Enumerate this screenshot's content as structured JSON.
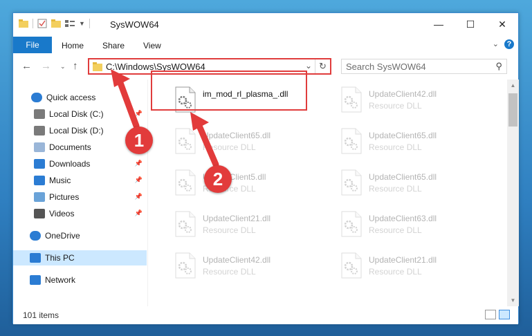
{
  "window": {
    "title": "SysWOW64",
    "controls": {
      "minimize": "—",
      "maximize": "☐",
      "close": "✕"
    }
  },
  "ribbon": {
    "tabs": [
      "File",
      "Home",
      "Share",
      "View"
    ],
    "help": "?"
  },
  "address": {
    "path": "C:\\Windows\\SysWOW64",
    "search_placeholder": "Search SysWOW64"
  },
  "nav": {
    "items": [
      {
        "label": "Quick access",
        "icon": "star-icon"
      },
      {
        "label": "Local Disk (C:)",
        "icon": "drive-icon",
        "pinned": true
      },
      {
        "label": "Local Disk (D:)",
        "icon": "drive-icon",
        "pinned": true
      },
      {
        "label": "Documents",
        "icon": "document-icon",
        "pinned": true
      },
      {
        "label": "Downloads",
        "icon": "download-icon",
        "pinned": true
      },
      {
        "label": "Music",
        "icon": "music-icon",
        "pinned": true
      },
      {
        "label": "Pictures",
        "icon": "pictures-icon",
        "pinned": true
      },
      {
        "label": "Videos",
        "icon": "video-icon",
        "pinned": true
      },
      {
        "label": "OneDrive",
        "icon": "cloud-icon"
      },
      {
        "label": "This PC",
        "icon": "computer-icon",
        "selected": true
      },
      {
        "label": "Network",
        "icon": "network-icon"
      }
    ]
  },
  "files": [
    {
      "name": "im_mod_rl_plasma_.dll",
      "type": ""
    },
    {
      "name": "UpdateClient42.dll",
      "type": "Resource DLL"
    },
    {
      "name": "UpdateClient65.dll",
      "type": "Resource DLL"
    },
    {
      "name": "UpdateClient65.dll",
      "type": "Resource DLL"
    },
    {
      "name": "UpdateClient5.dll",
      "type": "Resource DLL"
    },
    {
      "name": "UpdateClient65.dll",
      "type": "Resource DLL"
    },
    {
      "name": "UpdateClient21.dll",
      "type": "Resource DLL"
    },
    {
      "name": "UpdateClient63.dll",
      "type": "Resource DLL"
    },
    {
      "name": "UpdateClient42.dll",
      "type": "Resource DLL"
    },
    {
      "name": "UpdateClient21.dll",
      "type": "Resource DLL"
    }
  ],
  "status": {
    "item_count": "101 items"
  },
  "annotations": {
    "step1": "1",
    "step2": "2",
    "color": "#e23b3b"
  }
}
